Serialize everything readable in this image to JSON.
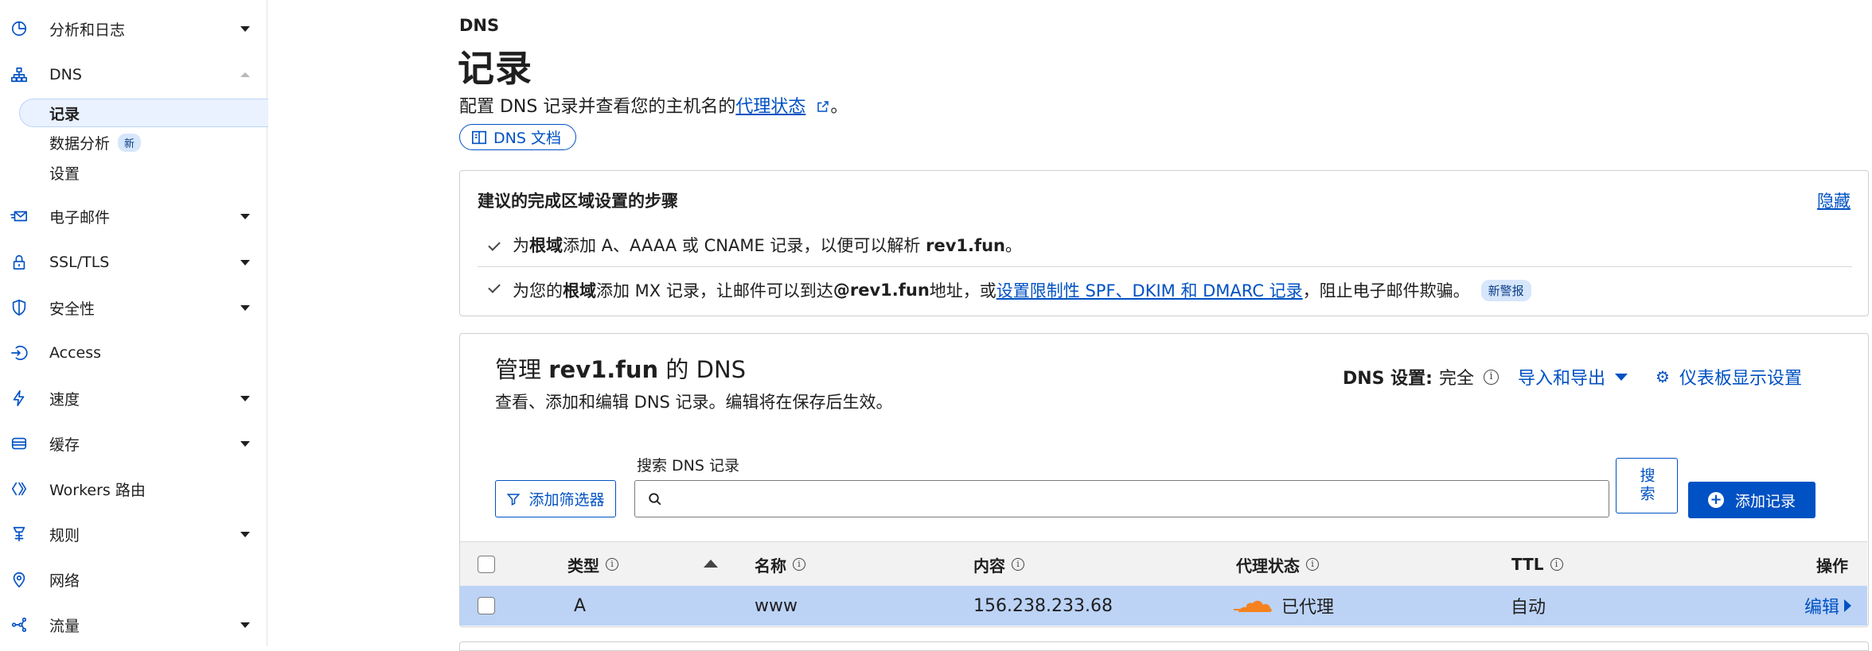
{
  "sidebar": {
    "items": [
      {
        "label": "分析和日志",
        "icon": "pie-chart-icon"
      },
      {
        "label": "DNS",
        "icon": "sitemap-icon"
      },
      {
        "label": "电子邮件",
        "icon": "email-icon"
      },
      {
        "label": "SSL/TLS",
        "icon": "lock-icon"
      },
      {
        "label": "安全性",
        "icon": "shield-icon"
      },
      {
        "label": "Access",
        "icon": "access-icon"
      },
      {
        "label": "速度",
        "icon": "bolt-icon"
      },
      {
        "label": "缓存",
        "icon": "cache-icon"
      },
      {
        "label": "Workers 路由",
        "icon": "workers-icon"
      },
      {
        "label": "规则",
        "icon": "rules-icon"
      },
      {
        "label": "网络",
        "icon": "location-pin-icon"
      },
      {
        "label": "流量",
        "icon": "traffic-icon"
      }
    ],
    "dns_sub": [
      {
        "label": "记录"
      },
      {
        "label": "数据分析",
        "badge": "新"
      },
      {
        "label": "设置"
      }
    ]
  },
  "header": {
    "eyebrow": "DNS",
    "title": "记录",
    "desc_prefix": "配置 DNS 记录并查看您的主机名的",
    "desc_link": "代理状态",
    "desc_suffix": "。",
    "docs_button": "DNS 文档"
  },
  "guide": {
    "title": "建议的完成区域设置的步骤",
    "hide": "隐藏",
    "step1": {
      "a": "为",
      "b": "根域",
      "c": "添加 A、AAAA 或 CNAME 记录，以便可以解析 ",
      "d": "rev1.fun",
      "e": "。"
    },
    "step2": {
      "a": "为您的",
      "b": "根域",
      "c": "添加 MX 记录，让邮件可以到达 ",
      "d": "@rev1.fun",
      "e": " 地址，或",
      "link": "设置限制性 SPF、DKIM 和 DMARC 记录",
      "f": "，阻止电子邮件欺骗。",
      "badge": "新警报"
    }
  },
  "manager": {
    "title_a": "管理 ",
    "title_domain": "rev1.fun",
    "title_b": " 的 DNS",
    "subtitle": "查看、添加和编辑 DNS 记录。编辑将在保存后生效。",
    "dns_setting_label": "DNS 设置:",
    "dns_setting_value": "完全",
    "import_export": "导入和导出",
    "dashboard_settings": "仪表板显示设置",
    "add_filter": "添加筛选器",
    "search_label": "搜索 DNS 记录",
    "search_value": "",
    "search_button": "搜索",
    "add_record": "添加记录"
  },
  "table": {
    "columns": [
      "类型",
      "名称",
      "内容",
      "代理状态",
      "TTL",
      "操作"
    ],
    "rows": [
      {
        "type": "A",
        "name": "www",
        "content": "156.238.233.68",
        "proxy": "已代理",
        "ttl": "自动",
        "action": "编辑"
      }
    ]
  },
  "colors": {
    "accent": "#0051c3",
    "row_selected": "#bcd3f6",
    "cloud": "#f6821f"
  }
}
